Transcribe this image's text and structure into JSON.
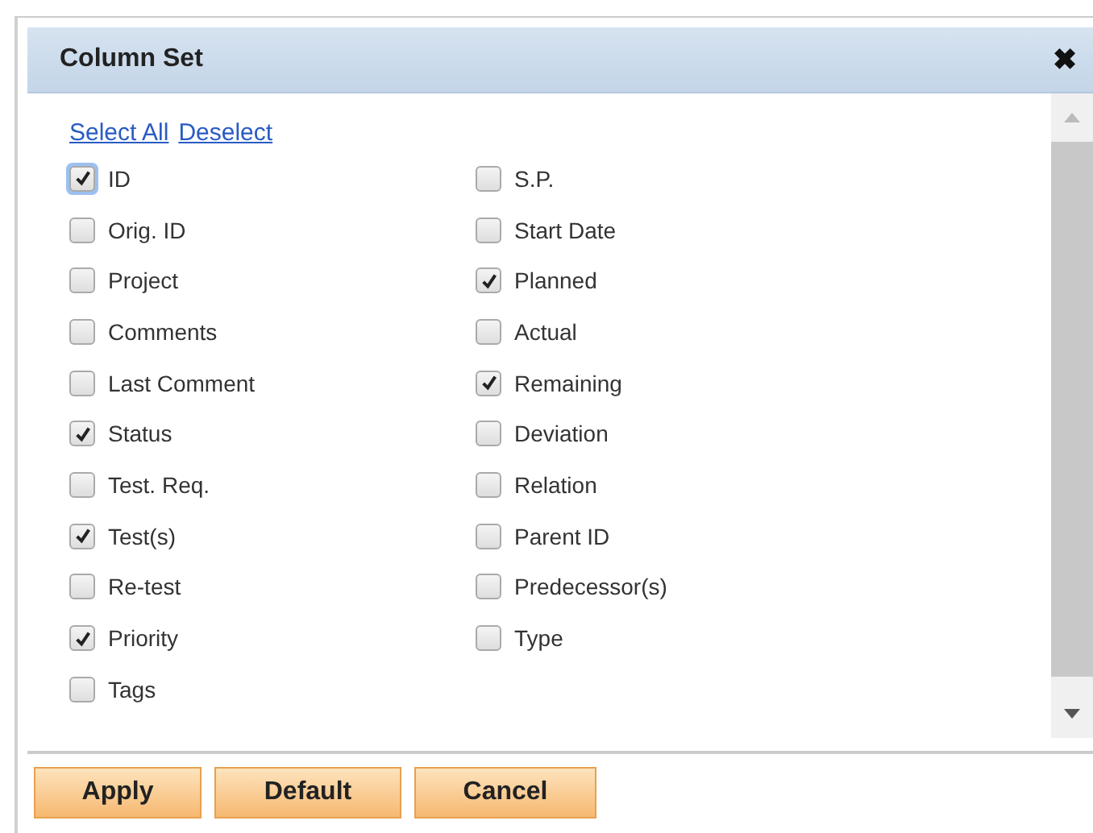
{
  "dialog": {
    "title": "Column Set",
    "close": "✖"
  },
  "links": [
    "Select All",
    "Deselect"
  ],
  "columns": [
    [
      {
        "label": "ID",
        "checked": true,
        "focused": true
      },
      {
        "label": "Orig. ID",
        "checked": false,
        "focused": false
      },
      {
        "label": "Project",
        "checked": false,
        "focused": false
      },
      {
        "label": "Comments",
        "checked": false,
        "focused": false
      },
      {
        "label": "Last Comment",
        "checked": false,
        "focused": false
      },
      {
        "label": "Status",
        "checked": true,
        "focused": false
      },
      {
        "label": "Test. Req.",
        "checked": false,
        "focused": false
      },
      {
        "label": "Test(s)",
        "checked": true,
        "focused": false
      },
      {
        "label": "Re-test",
        "checked": false,
        "focused": false
      },
      {
        "label": "Priority",
        "checked": true,
        "focused": false
      },
      {
        "label": "Tags",
        "checked": false,
        "focused": false
      }
    ],
    [
      {
        "label": "S.P.",
        "checked": false,
        "focused": false
      },
      {
        "label": "Start Date",
        "checked": false,
        "focused": false
      },
      {
        "label": "Planned",
        "checked": true,
        "focused": false
      },
      {
        "label": "Actual",
        "checked": false,
        "focused": false
      },
      {
        "label": "Remaining",
        "checked": true,
        "focused": false
      },
      {
        "label": "Deviation",
        "checked": false,
        "focused": false
      },
      {
        "label": "Relation",
        "checked": false,
        "focused": false
      },
      {
        "label": "Parent ID",
        "checked": false,
        "focused": false
      },
      {
        "label": "Predecessor(s)",
        "checked": false,
        "focused": false
      },
      {
        "label": "Type",
        "checked": false,
        "focused": false
      }
    ]
  ],
  "buttons": [
    "Apply",
    "Default",
    "Cancel"
  ]
}
